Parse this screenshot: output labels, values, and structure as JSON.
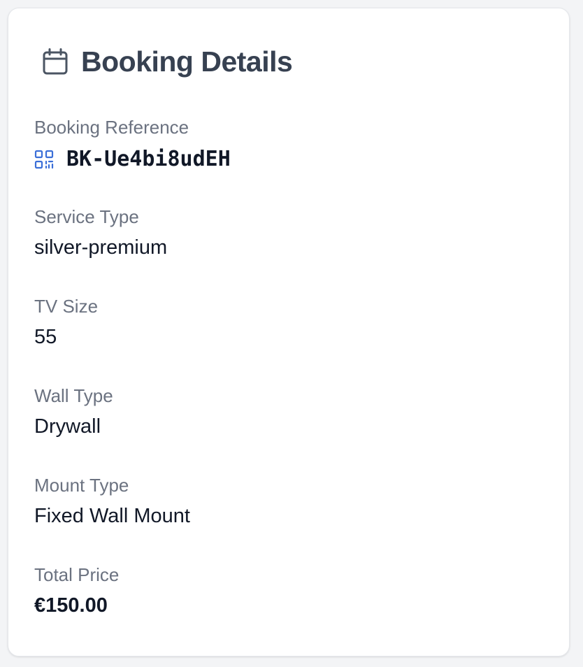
{
  "card": {
    "title": "Booking Details",
    "title_icon": "calendar-icon"
  },
  "booking_reference": {
    "label": "Booking Reference",
    "value": "BK-Ue4bi8udEH",
    "icon": "qr-code-icon"
  },
  "service_type": {
    "label": "Service Type",
    "value": "silver-premium"
  },
  "tv_size": {
    "label": "TV Size",
    "value": "55"
  },
  "wall_type": {
    "label": "Wall Type",
    "value": "Drywall"
  },
  "mount_type": {
    "label": "Mount Type",
    "value": "Fixed Wall Mount"
  },
  "total_price": {
    "label": "Total Price",
    "value": "€150.00"
  },
  "colors": {
    "accent": "#3b6fd8",
    "title": "#374151",
    "label": "#6b7280",
    "value": "#111827"
  }
}
